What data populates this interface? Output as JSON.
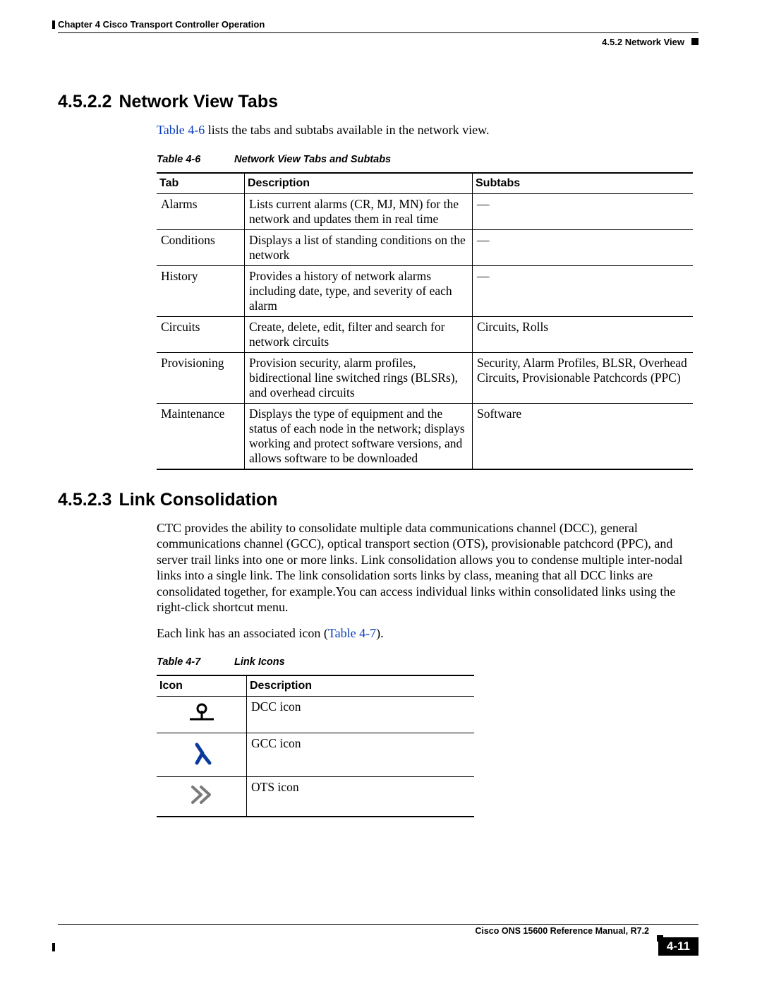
{
  "header": {
    "chapter_line": "Chapter 4    Cisco Transport Controller Operation",
    "section_ref": "4.5.2  Network View"
  },
  "section1": {
    "number": "4.5.2.2",
    "title": "Network View Tabs",
    "intro_link": "Table 4-6",
    "intro_rest": " lists the tabs and subtabs available in the network view."
  },
  "table1": {
    "caption_num": "Table 4-6",
    "caption_title": "Network View Tabs and Subtabs",
    "headers": {
      "c1": "Tab",
      "c2": "Description",
      "c3": "Subtabs"
    },
    "rows": [
      {
        "tab": "Alarms",
        "desc": "Lists current alarms (CR, MJ, MN) for the network and updates them in real time",
        "sub": "—"
      },
      {
        "tab": "Conditions",
        "desc": "Displays a list of standing conditions on the network",
        "sub": "—"
      },
      {
        "tab": "History",
        "desc": "Provides a history of network alarms including date, type, and severity of each alarm",
        "sub": "—"
      },
      {
        "tab": "Circuits",
        "desc": "Create, delete, edit, filter and search for network circuits",
        "sub": "Circuits, Rolls"
      },
      {
        "tab": "Provisioning",
        "desc": "Provision security, alarm profiles, bidirectional line switched rings (BLSRs), and overhead circuits",
        "sub": "Security, Alarm Profiles, BLSR, Overhead Circuits, Provisionable Patchcords (PPC)"
      },
      {
        "tab": "Maintenance",
        "desc": "Displays the type of equipment and the status of each node in the network; displays working and protect software versions, and allows software to be downloaded",
        "sub": "Software"
      }
    ]
  },
  "section2": {
    "number": "4.5.2.3",
    "title": "Link Consolidation",
    "para1": "CTC provides the ability to consolidate multiple data communications channel (DCC), general communications channel (GCC), optical transport section (OTS), provisionable patchcord (PPC), and server trail links into one or more links. Link consolidation allows you to condense multiple inter-nodal links into a single link. The link consolidation sorts links by class, meaning that all DCC links are consolidated together, for example.You can access individual links within consolidated links using the right-click shortcut menu.",
    "para2_pre": "Each link has an associated icon (",
    "para2_link": "Table 4-7",
    "para2_post": ")."
  },
  "table2": {
    "caption_num": "Table 4-7",
    "caption_title": "Link Icons",
    "headers": {
      "c1": "Icon",
      "c2": "Description"
    },
    "rows": [
      {
        "desc": "DCC icon",
        "icon": "dcc"
      },
      {
        "desc": "GCC icon",
        "icon": "gcc"
      },
      {
        "desc": "OTS icon",
        "icon": "ots"
      }
    ]
  },
  "footer": {
    "manual": "Cisco ONS 15600 Reference Manual, R7.2",
    "page_number": "4-11"
  }
}
